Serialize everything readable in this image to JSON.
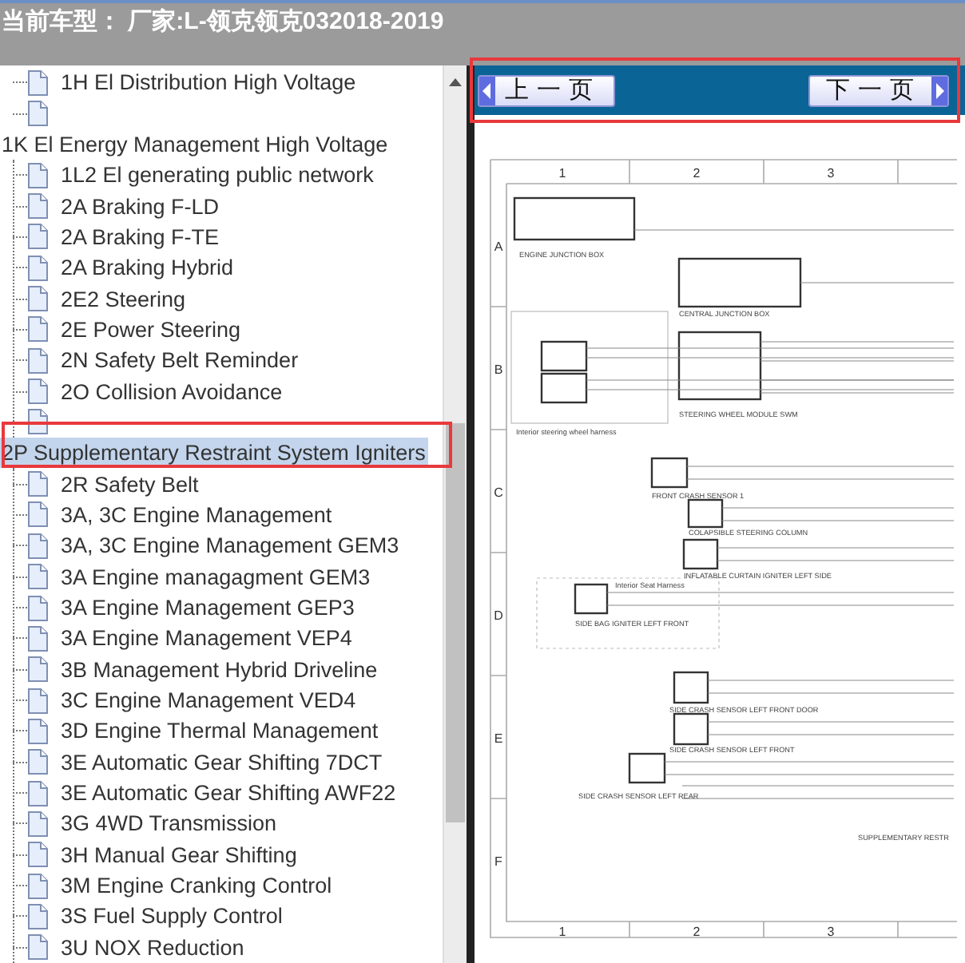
{
  "header": {
    "title": "当前车型： 厂家:L-领克领克032018-2019"
  },
  "tree": [
    {
      "kind": "page",
      "label": "1H El Distribution High Voltage",
      "selected": false
    },
    {
      "kind": "page",
      "selected": false
    },
    {
      "kind": "folder",
      "label": "1K El Energy Management High Voltage",
      "selected": false,
      "children": [
        {
          "kind": "page",
          "label": "1L2 El generating public network",
          "selected": false
        },
        {
          "kind": "page",
          "label": "2A Braking F-LD",
          "selected": false
        },
        {
          "kind": "page",
          "label": "2A Braking F-TE",
          "selected": false
        },
        {
          "kind": "page",
          "label": "2A Braking Hybrid",
          "selected": false
        },
        {
          "kind": "page",
          "label": "2E2 Steering",
          "selected": false
        },
        {
          "kind": "page",
          "label": "2E Power Steering",
          "selected": false
        },
        {
          "kind": "page",
          "label": "2N Safety Belt Reminder",
          "selected": false
        },
        {
          "kind": "page",
          "label": "2O Collision Avoidance",
          "selected": false
        },
        {
          "kind": "page",
          "selected": false
        }
      ]
    },
    {
      "kind": "folder",
      "label": "2P Supplementary Restraint System Igniters",
      "selected": true,
      "children": [
        {
          "kind": "page",
          "label": "2R Safety Belt",
          "selected": false
        },
        {
          "kind": "page",
          "label": "3A, 3C Engine Management",
          "selected": false
        },
        {
          "kind": "page",
          "label": "3A, 3C Engine Management GEM3",
          "selected": false
        },
        {
          "kind": "page",
          "label": "3A Engine managagment GEM3",
          "selected": false
        },
        {
          "kind": "page",
          "label": "3A Engine Management GEP3",
          "selected": false
        },
        {
          "kind": "page",
          "label": "3A Engine Management VEP4",
          "selected": false
        },
        {
          "kind": "page",
          "label": "3B Management Hybrid Driveline",
          "selected": false
        },
        {
          "kind": "page",
          "label": "3C Engine Management VED4",
          "selected": false
        },
        {
          "kind": "page",
          "label": "3D Engine Thermal Management",
          "selected": false
        },
        {
          "kind": "page",
          "label": "3E Automatic Gear Shifting 7DCT",
          "selected": false
        },
        {
          "kind": "page",
          "label": "3E Automatic Gear Shifting AWF22",
          "selected": false
        },
        {
          "kind": "page",
          "label": "3G 4WD Transmission",
          "selected": false
        },
        {
          "kind": "page",
          "label": "3H Manual Gear Shifting",
          "selected": false
        },
        {
          "kind": "page",
          "label": "3M Engine Cranking Control",
          "selected": false
        },
        {
          "kind": "page",
          "label": "3S Fuel Supply Control",
          "selected": false
        },
        {
          "kind": "page",
          "label": "3U NOX Reduction",
          "selected": false
        }
      ]
    }
  ],
  "toolbar": {
    "prev_button": "上一页",
    "next_button": "下一页"
  },
  "diagram": {
    "column_labels": [
      "1",
      "2",
      "3"
    ],
    "row_labels": [
      "A",
      "B",
      "C",
      "D",
      "E",
      "F"
    ],
    "bottom_column_labels": [
      "1",
      "2",
      "3"
    ],
    "component_labels": [
      "ENGINE JUNCTION BOX",
      "CENTRAL JUNCTION BOX",
      "Interior steering wheel harness",
      "STEERING WHEEL MODULE SWM",
      "FRONT CRASH SENSOR 1",
      "COLAPSIBLE STEERING COLUMN",
      "INFLATABLE CURTAIN IGNITER LEFT SIDE",
      "Interior Seat Harness",
      "SIDE BAG IGNITER LEFT FRONT",
      "SIDE CRASH SENSOR LEFT FRONT DOOR",
      "SIDE CRASH SENSOR LEFT FRONT",
      "SIDE CRASH SENSOR LEFT REAR",
      "SUPPLEMENTARY RESTR"
    ]
  },
  "highlights": {
    "toolbar": true,
    "selected_item": true
  }
}
